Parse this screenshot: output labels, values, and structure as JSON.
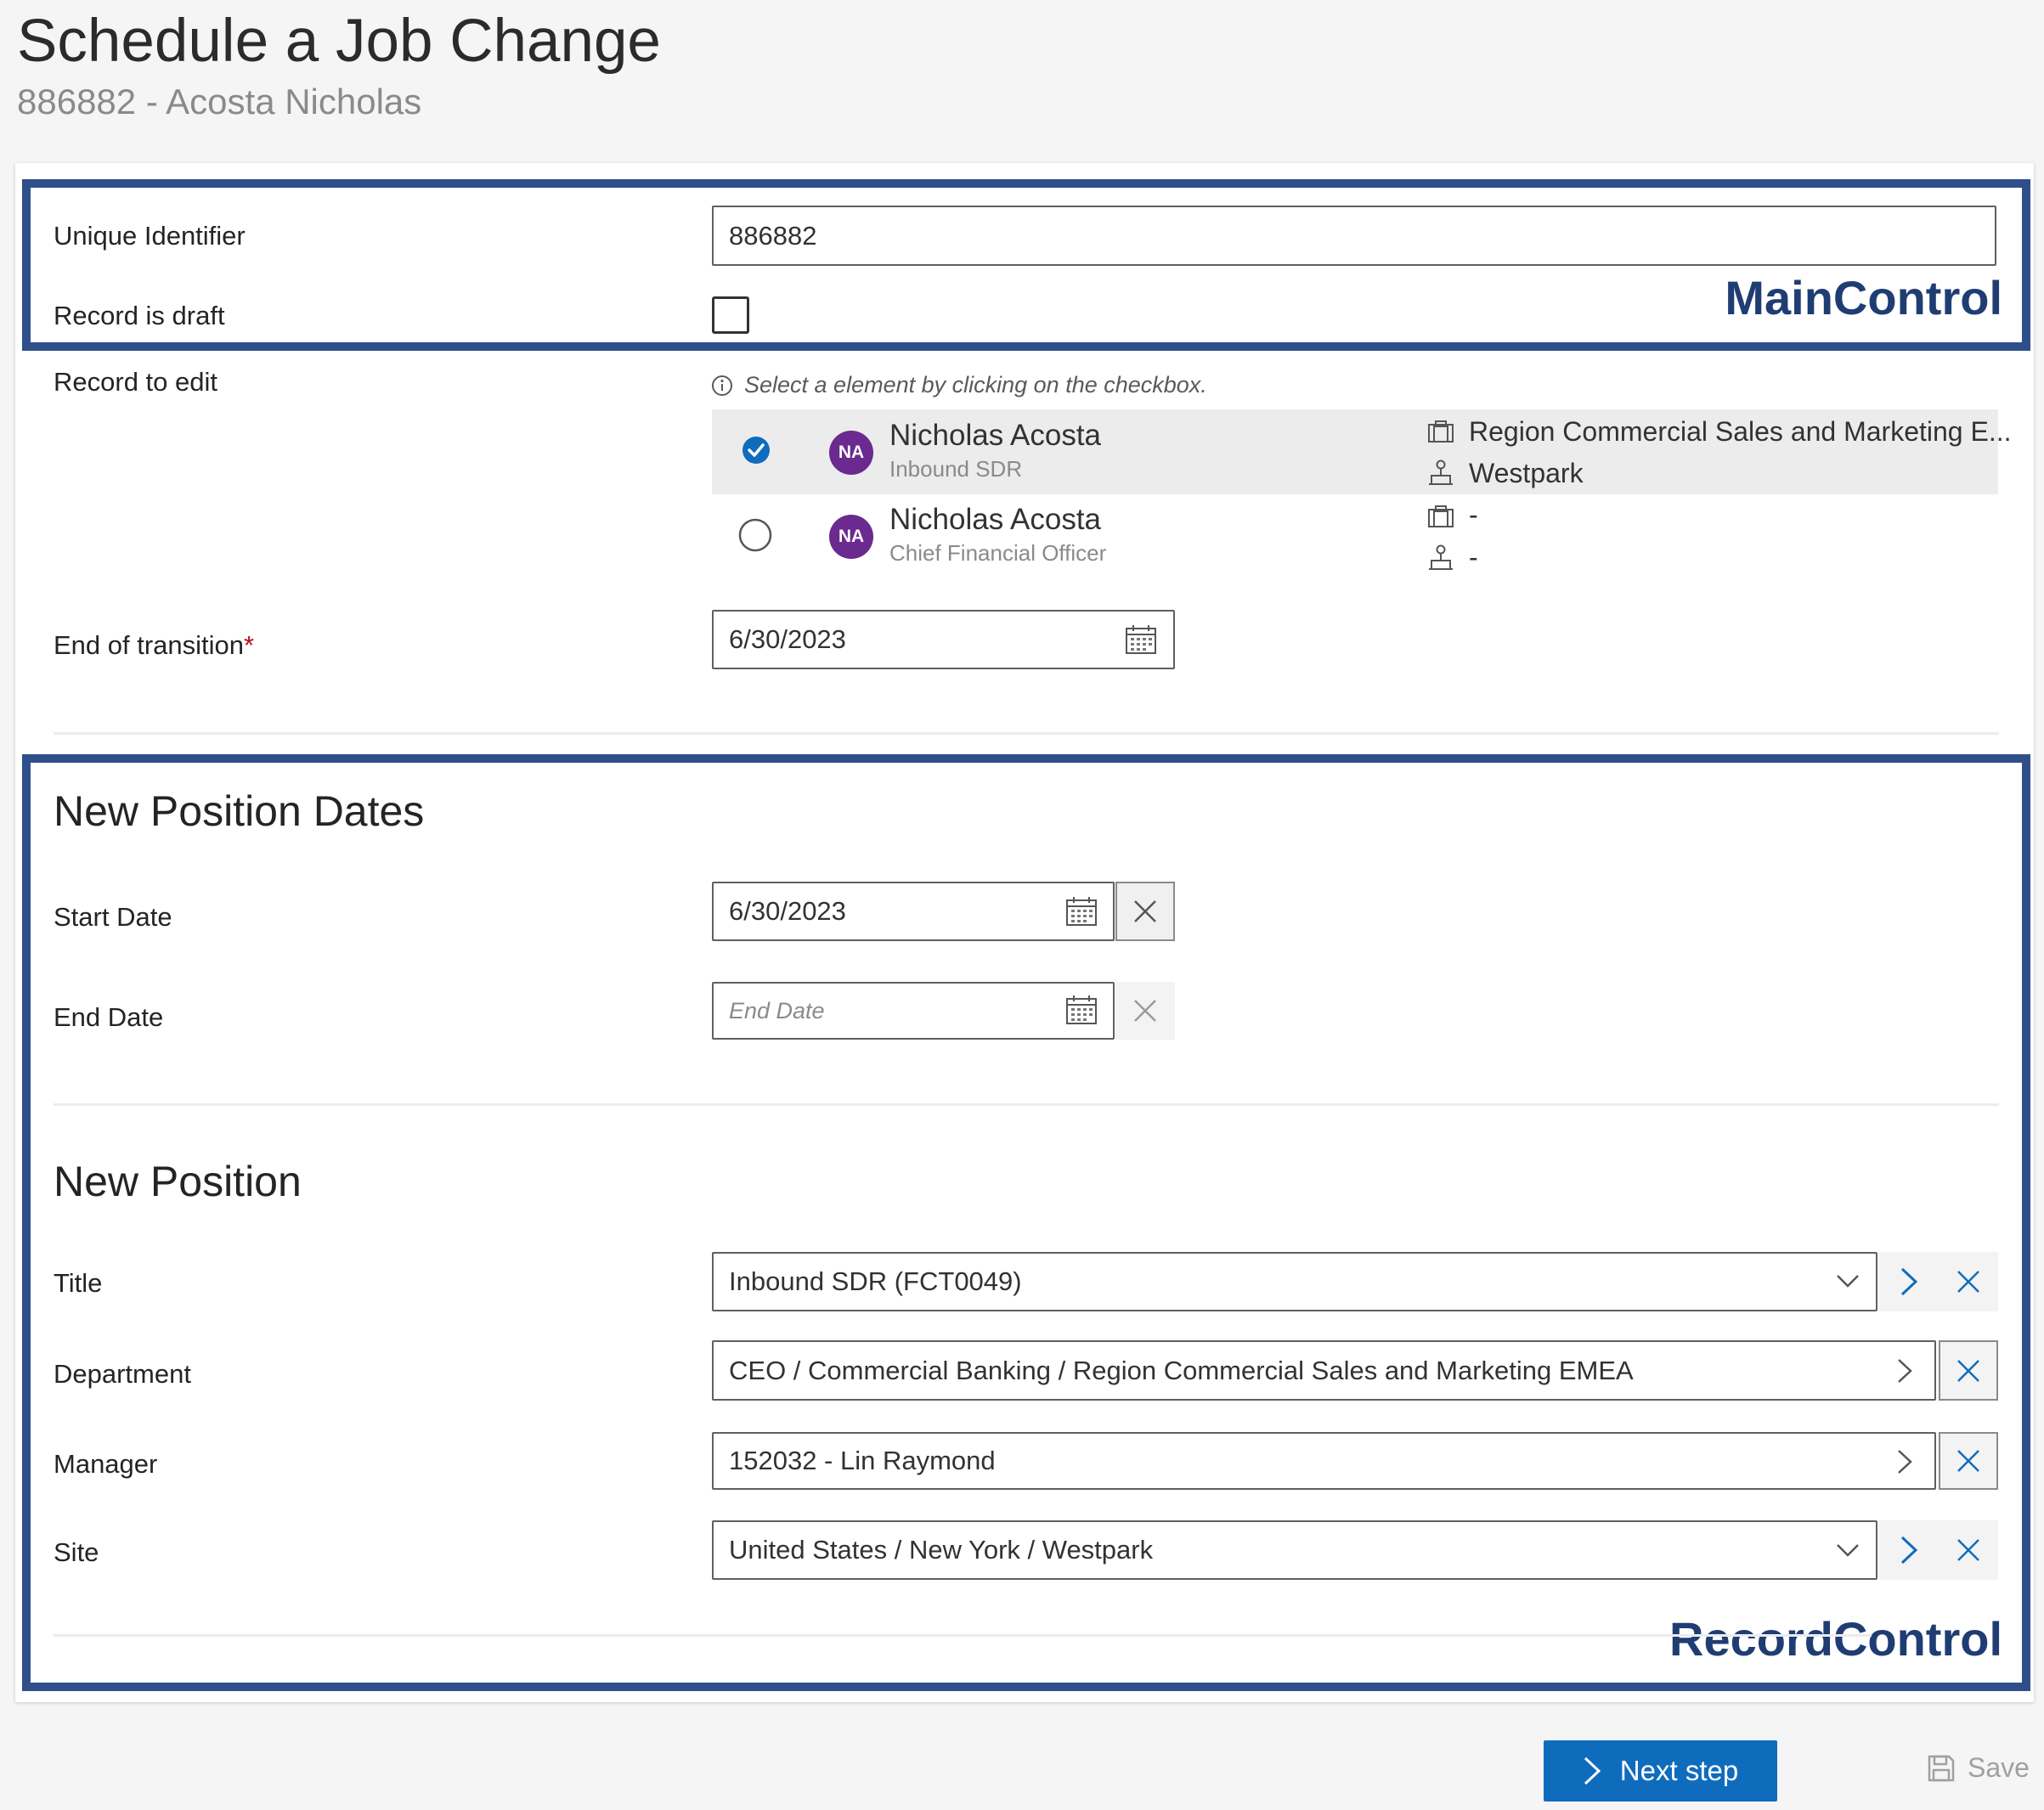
{
  "header": {
    "title": "Schedule a Job Change",
    "subtitle": "886882 - Acosta Nicholas"
  },
  "annotations": {
    "main_control": "MainControl",
    "record_control": "RecordControl"
  },
  "main": {
    "unique_identifier_label": "Unique Identifier",
    "unique_identifier_value": "886882",
    "record_is_draft_label": "Record is draft",
    "record_is_draft_checked": false
  },
  "record_to_edit": {
    "label": "Record to edit",
    "hint": "Select a element by clicking on the checkbox.",
    "records": [
      {
        "initials": "NA",
        "name": "Nicholas Acosta",
        "role": "Inbound SDR",
        "department": "Region Commercial Sales and Marketing E...",
        "site": "Westpark",
        "selected": true
      },
      {
        "initials": "NA",
        "name": "Nicholas Acosta",
        "role": "Chief Financial Officer",
        "department": "-",
        "site": "-",
        "selected": false
      }
    ]
  },
  "end_of_transition": {
    "label": "End of transition",
    "required_marker": "*",
    "value": "6/30/2023"
  },
  "new_position_dates": {
    "section_title": "New Position Dates",
    "start_date_label": "Start Date",
    "start_date_value": "6/30/2023",
    "end_date_label": "End Date",
    "end_date_placeholder": "End Date"
  },
  "new_position": {
    "section_title": "New Position",
    "title_label": "Title",
    "title_value": "Inbound SDR (FCT0049)",
    "department_label": "Department",
    "department_value": "CEO / Commercial Banking / Region Commercial Sales and Marketing EMEA",
    "manager_label": "Manager",
    "manager_value": "152032 - Lin Raymond",
    "site_label": "Site",
    "site_value": "United States / New York / Westpark"
  },
  "footer": {
    "next_step_label": "Next step",
    "save_label": "Save"
  },
  "colors": {
    "accent": "#0f6cbd",
    "annotation": "#2f4f8a",
    "avatar": "#6a2a8f"
  }
}
